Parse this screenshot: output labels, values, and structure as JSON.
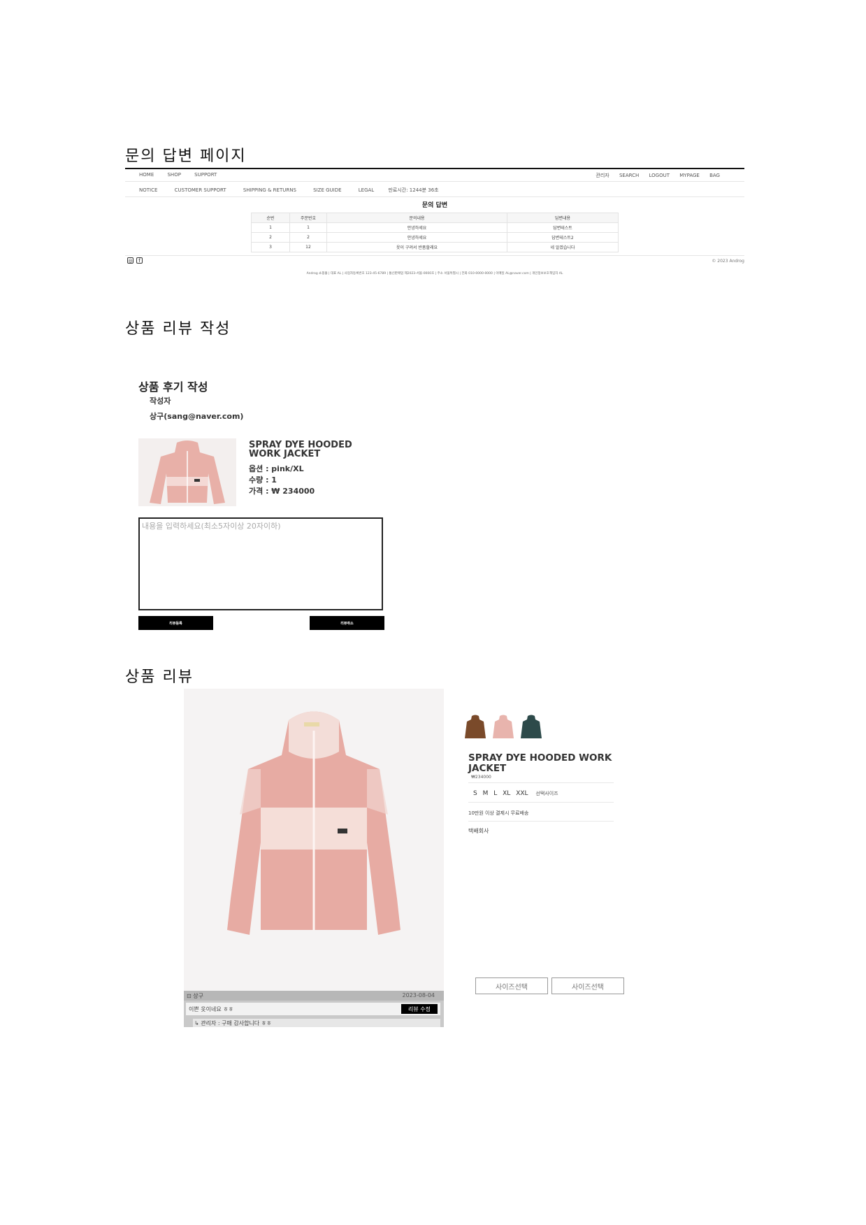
{
  "sections": {
    "inquiry": "문의 답변 페이지",
    "review_write": "상품 리뷰 작성",
    "review": "상품 리뷰"
  },
  "header": {
    "nav_left": [
      "HOME",
      "SHOP",
      "SUPPORT"
    ],
    "nav_right": [
      "관리자",
      "SEARCH",
      "LOGOUT",
      "MYPAGE",
      "BAG"
    ],
    "sub_nav": [
      "NOTICE",
      "CUSTOMER SUPPORT",
      "SHIPPING & RETURNS",
      "SIZE GUIDE",
      "LEGAL"
    ],
    "session": "만료시간: 1244분 36초"
  },
  "inquiry": {
    "title": "문의 답변",
    "columns": [
      "순번",
      "주문번호",
      "문의내용",
      "답변내용"
    ],
    "rows": [
      [
        "1",
        "1",
        "안녕하세요",
        "답변테스트"
      ],
      [
        "2",
        "2",
        "안녕하세요",
        "답변테스트2"
      ],
      [
        "3",
        "12",
        "옷이 구려서 반품할래요",
        "네 알겠습니다"
      ]
    ]
  },
  "footer": {
    "copyright": "© 2023 Androg",
    "business_info": "Androg 쇼핑몰 | 대표 AL | 사업자등록번호 123-45-6789 | 통신판매업 제2023-서울-0000호 | 주소 서울특별시 | 전화 010-0000-0000 | 이메일 AL@naver.com | 개인정보보호책임자 AL"
  },
  "review_form": {
    "heading": "상품 후기 작성",
    "writer_label": "작성자",
    "writer": "상구(sang@naver.com)",
    "product_name": "SPRAY DYE HOODED WORK JACKET",
    "option": "옵션 : pink/XL",
    "quantity": "수량 : 1",
    "price": "가격 : ₩ 234000",
    "placeholder": "내용을 입력하세요(최소5자이상 20자이하)",
    "submit": "리뷰등록",
    "cancel": "리뷰취소"
  },
  "product": {
    "name": "SPRAY DYE HOODED WORK JACKET",
    "price": "₩234000",
    "sizes": [
      "S",
      "M",
      "L",
      "XL",
      "XXL"
    ],
    "size_select": "선택사이즈",
    "shipping_note": "10만원 이상 결제시 무료배송",
    "courier": "택배회사",
    "size_buttons": [
      "사이즈선택",
      "사이즈선택"
    ],
    "colors": [
      "#7a4a2a",
      "#e8b4ad",
      "#2d4a4a"
    ]
  },
  "review_list": {
    "user": "상구",
    "date": "2023-08-04",
    "text": "이쁜 옷이네요 ㅎㅎ",
    "edit": "리뷰 수정",
    "reply": "↳ 관리자 : 구매 감사합니다 ㅎㅎ"
  }
}
